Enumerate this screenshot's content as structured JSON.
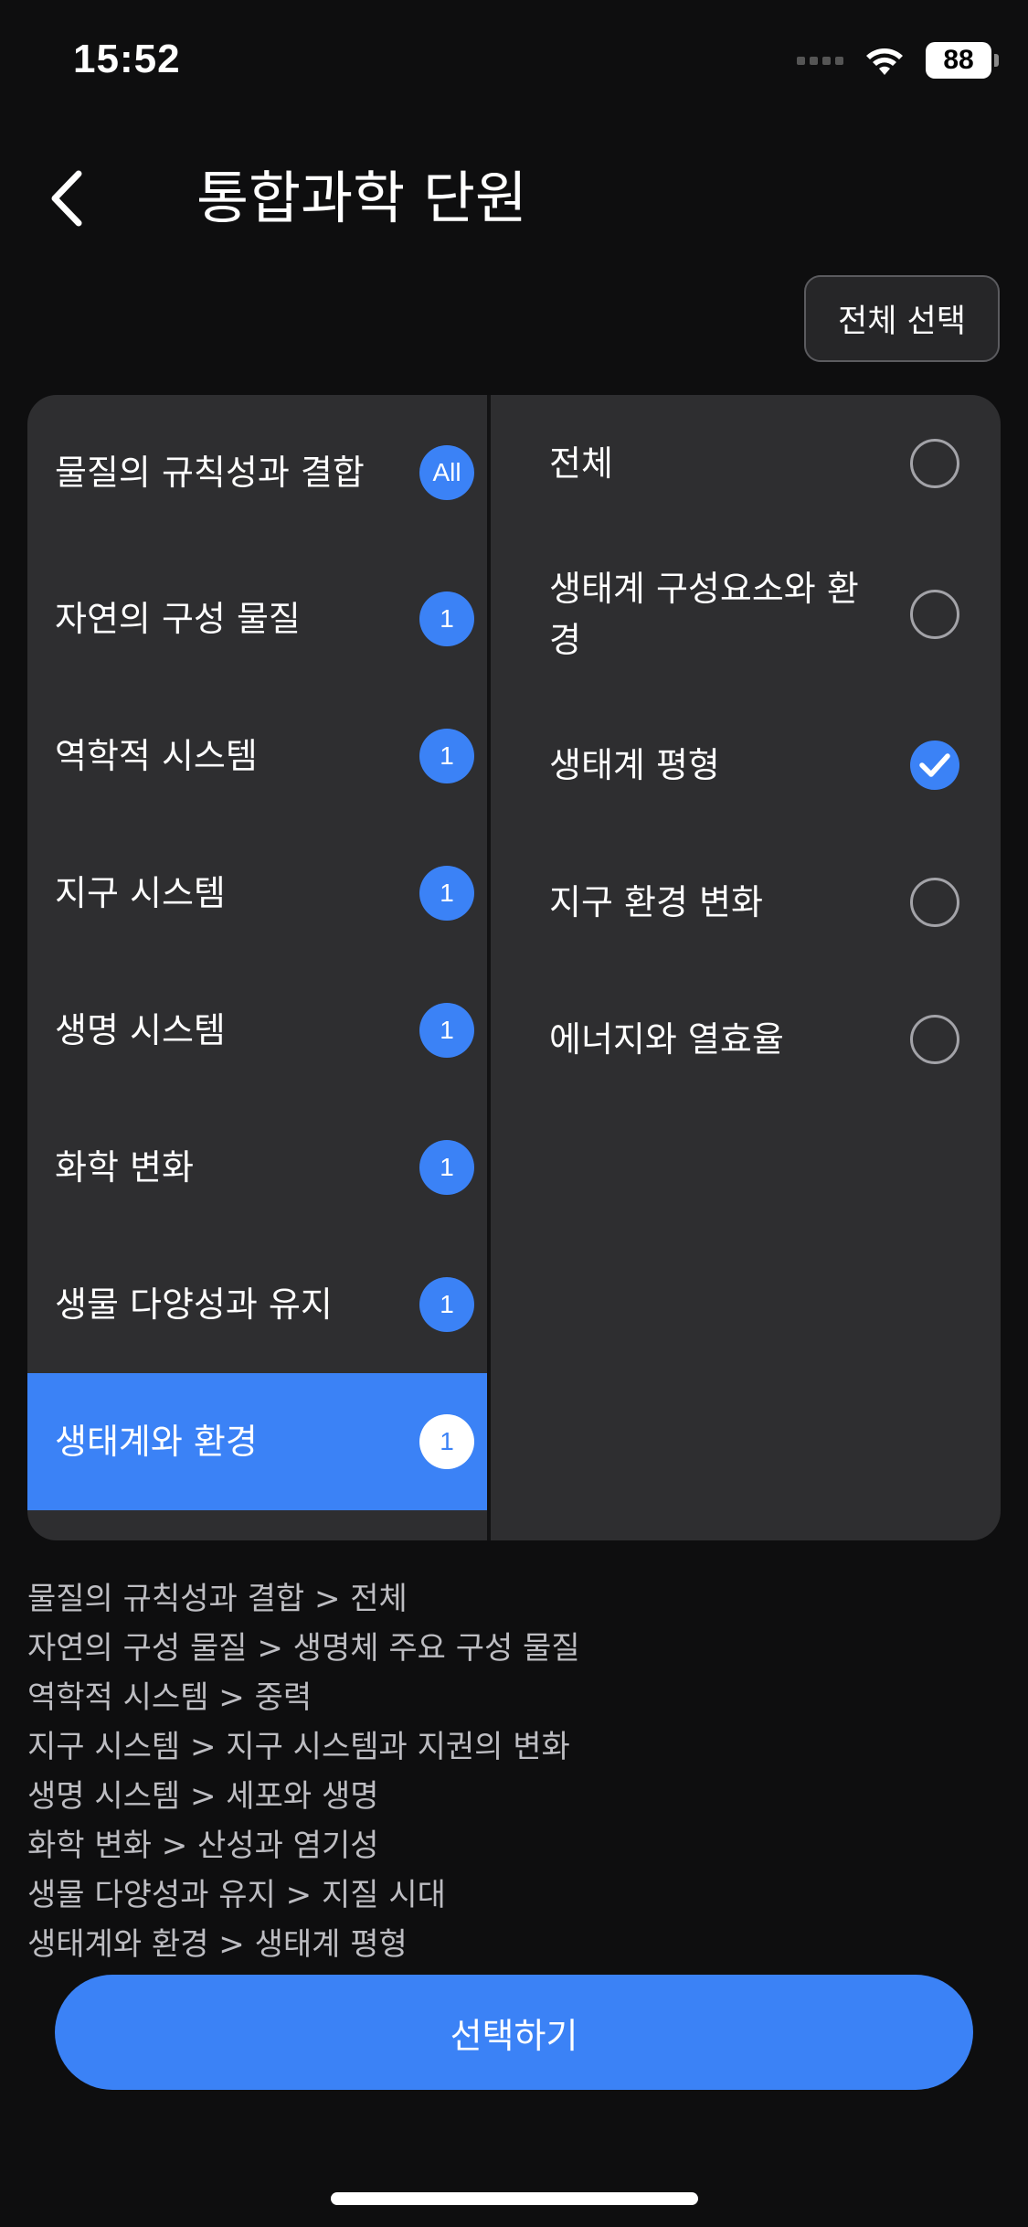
{
  "status_bar": {
    "time": "15:52",
    "battery": "88"
  },
  "header": {
    "title": "통합과학 단원"
  },
  "select_all_label": "전체 선택",
  "left_list": [
    {
      "label": "물질의 규칙성과 결합",
      "badge": "All",
      "selected": false
    },
    {
      "label": "자연의 구성 물질",
      "badge": "1",
      "selected": false
    },
    {
      "label": "역학적 시스템",
      "badge": "1",
      "selected": false
    },
    {
      "label": "지구 시스템",
      "badge": "1",
      "selected": false
    },
    {
      "label": "생명 시스템",
      "badge": "1",
      "selected": false
    },
    {
      "label": "화학 변화",
      "badge": "1",
      "selected": false
    },
    {
      "label": "생물 다양성과 유지",
      "badge": "1",
      "selected": false
    },
    {
      "label": "생태계와 환경",
      "badge": "1",
      "selected": true
    }
  ],
  "right_list": [
    {
      "label": "전체",
      "checked": false
    },
    {
      "label": "생태계 구성요소와 환경",
      "checked": false
    },
    {
      "label": "생태계 평형",
      "checked": true
    },
    {
      "label": "지구 환경 변화",
      "checked": false
    },
    {
      "label": "에너지와 열효율",
      "checked": false
    }
  ],
  "summary": [
    "물질의 규칙성과 결합 > 전체",
    "자연의 구성 물질 > 생명체 주요 구성 물질",
    "역학적 시스템 > 중력",
    "지구 시스템 > 지구 시스템과 지권의 변화",
    "생명 시스템 > 세포와 생명",
    "화학 변화 > 산성과 염기성",
    "생물 다양성과 유지 > 지질 시대",
    "생태계와 환경 > 생태계 평형"
  ],
  "submit_label": "선택하기",
  "colors": {
    "accent": "#3b82f6",
    "background": "#0e0e0f",
    "panel": "#2e2e30"
  }
}
